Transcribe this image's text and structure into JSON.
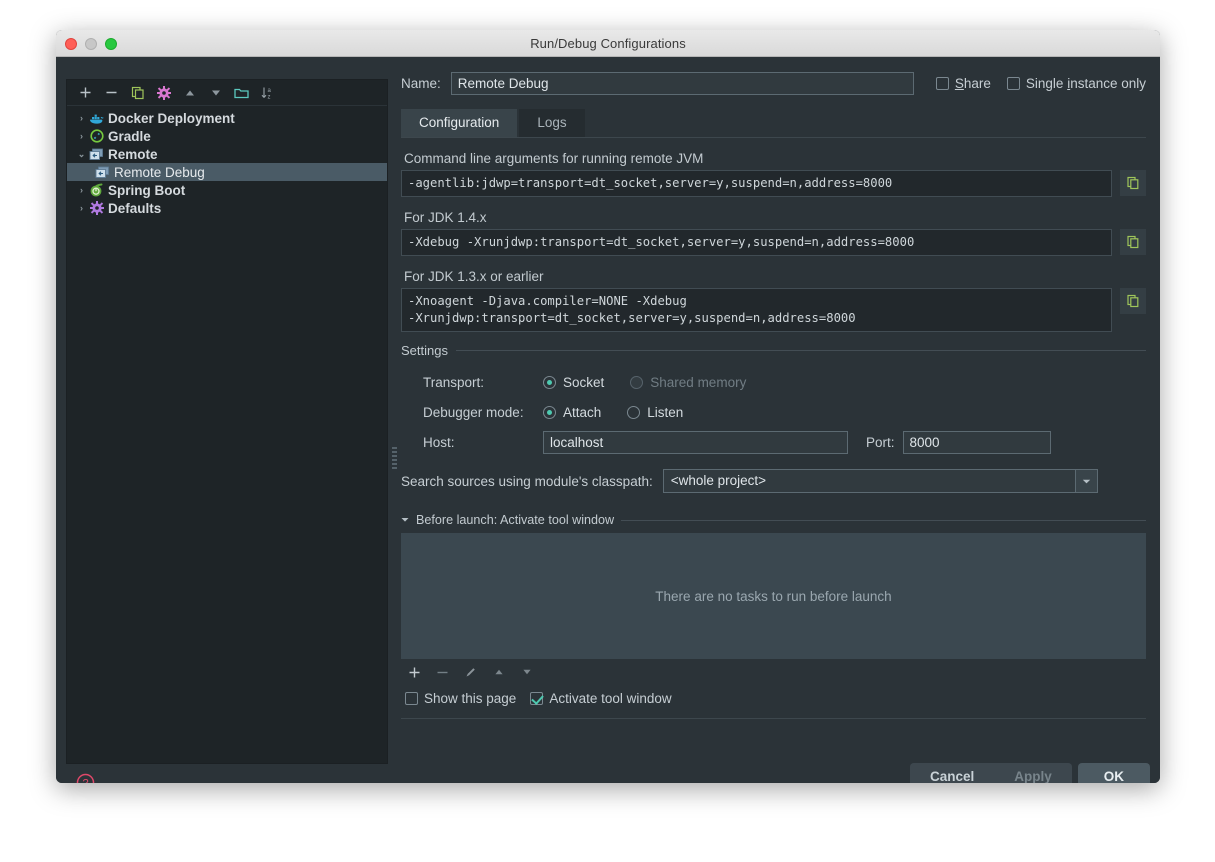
{
  "window": {
    "title": "Run/Debug Configurations",
    "traffic_lights": [
      "close",
      "minimize",
      "zoom"
    ]
  },
  "tree_toolbar": {
    "icons": [
      {
        "name": "add-icon",
        "glyph": "+"
      },
      {
        "name": "remove-icon",
        "glyph": "−"
      },
      {
        "name": "copy-configuration-icon",
        "glyph": "copy"
      },
      {
        "name": "edit-templates-gear-icon",
        "glyph": "gear"
      },
      {
        "name": "move-up-icon",
        "glyph": "▲"
      },
      {
        "name": "move-down-icon",
        "glyph": "▼"
      },
      {
        "name": "new-folder-icon",
        "glyph": "folder"
      },
      {
        "name": "sort-alphabetically-icon",
        "glyph": "sort-az"
      }
    ]
  },
  "tree": {
    "items": [
      {
        "label": "Docker Deployment",
        "twisty": "›",
        "icon": "docker-icon",
        "level": 0,
        "selected": false
      },
      {
        "label": "Gradle",
        "twisty": "›",
        "icon": "gradle-icon",
        "level": 0,
        "selected": false
      },
      {
        "label": "Remote",
        "twisty": "⌄",
        "icon": "remote-icon",
        "level": 0,
        "selected": false
      },
      {
        "label": "Remote Debug",
        "twisty": "",
        "icon": "remote-icon",
        "level": 1,
        "selected": true
      },
      {
        "label": "Spring Boot",
        "twisty": "›",
        "icon": "spring-boot-icon",
        "level": 0,
        "selected": false
      },
      {
        "label": "Defaults",
        "twisty": "›",
        "icon": "defaults-gear-icon",
        "level": 0,
        "selected": false
      }
    ]
  },
  "name_row": {
    "label": "Name:",
    "value": "Remote Debug",
    "share": {
      "label_pre": "",
      "label_underlined": "S",
      "label_post": "hare",
      "checked": false
    },
    "single_instance": {
      "label_pre": "Single ",
      "label_underlined": "i",
      "label_post": "nstance only",
      "checked": false
    }
  },
  "tabs": [
    {
      "label": "Configuration",
      "active": true
    },
    {
      "label": "Logs",
      "active": false
    }
  ],
  "fields": {
    "cmdline": {
      "label": "Command line arguments for running remote JVM",
      "value": "-agentlib:jdwp=transport=dt_socket,server=y,suspend=n,address=8000",
      "copy_icon": "copy-icon"
    },
    "jdk14": {
      "label": "For JDK 1.4.x",
      "value": "-Xdebug -Xrunjdwp:transport=dt_socket,server=y,suspend=n,address=8000",
      "copy_icon": "copy-icon"
    },
    "jdk13": {
      "label": "For JDK 1.3.x or earlier",
      "value": "-Xnoagent -Djava.compiler=NONE -Xdebug\n-Xrunjdwp:transport=dt_socket,server=y,suspend=n,address=8000",
      "copy_icon": "copy-icon"
    }
  },
  "settings": {
    "title": "Settings",
    "transport": {
      "label": "Transport:",
      "options": [
        {
          "label": "Socket",
          "selected": true,
          "disabled": false
        },
        {
          "label": "Shared memory",
          "selected": false,
          "disabled": true
        }
      ]
    },
    "debugger_mode": {
      "label": "Debugger mode:",
      "options": [
        {
          "label": "Attach",
          "selected": true,
          "disabled": false
        },
        {
          "label": "Listen",
          "selected": false,
          "disabled": false
        }
      ]
    },
    "host": {
      "label": "Host:",
      "value": "localhost"
    },
    "port": {
      "label": "Port:",
      "value": "8000"
    }
  },
  "classpath": {
    "label": "Search sources using module's classpath:",
    "value": "<whole project>",
    "arrow_icon": "chevron-down-icon"
  },
  "before_launch": {
    "title": "Before launch: Activate tool window",
    "collapse_icon": "triangle-down-icon",
    "empty_message": "There are no tasks to run before launch",
    "toolbar_icons": [
      {
        "name": "add-task-icon",
        "glyph": "+"
      },
      {
        "name": "remove-task-icon",
        "glyph": "−"
      },
      {
        "name": "edit-task-icon",
        "glyph": "pencil"
      },
      {
        "name": "move-task-up-icon",
        "glyph": "▲"
      },
      {
        "name": "move-task-down-icon",
        "glyph": "▼"
      }
    ],
    "show_this_page": {
      "label": "Show this page",
      "checked": false
    },
    "activate_tool_window": {
      "label": "Activate tool window",
      "checked": true
    }
  },
  "footer": {
    "help_icon": "help-icon",
    "buttons": [
      {
        "label": "Cancel",
        "name": "cancel-button",
        "disabled": false,
        "primary": false
      },
      {
        "label": "Apply",
        "name": "apply-button",
        "disabled": true,
        "primary": false
      },
      {
        "label": "OK",
        "name": "ok-button",
        "disabled": false,
        "primary": true
      }
    ]
  },
  "colors": {
    "dialog_bg": "#2b3338",
    "tree_bg": "#1e2427",
    "selection": "#4a5b66",
    "accent_teal": "#4ec9b0",
    "accent_green": "#9fc55a",
    "accent_magenta": "#d977d0",
    "help_red": "#e0486a",
    "panel_bg": "#3b4850"
  }
}
